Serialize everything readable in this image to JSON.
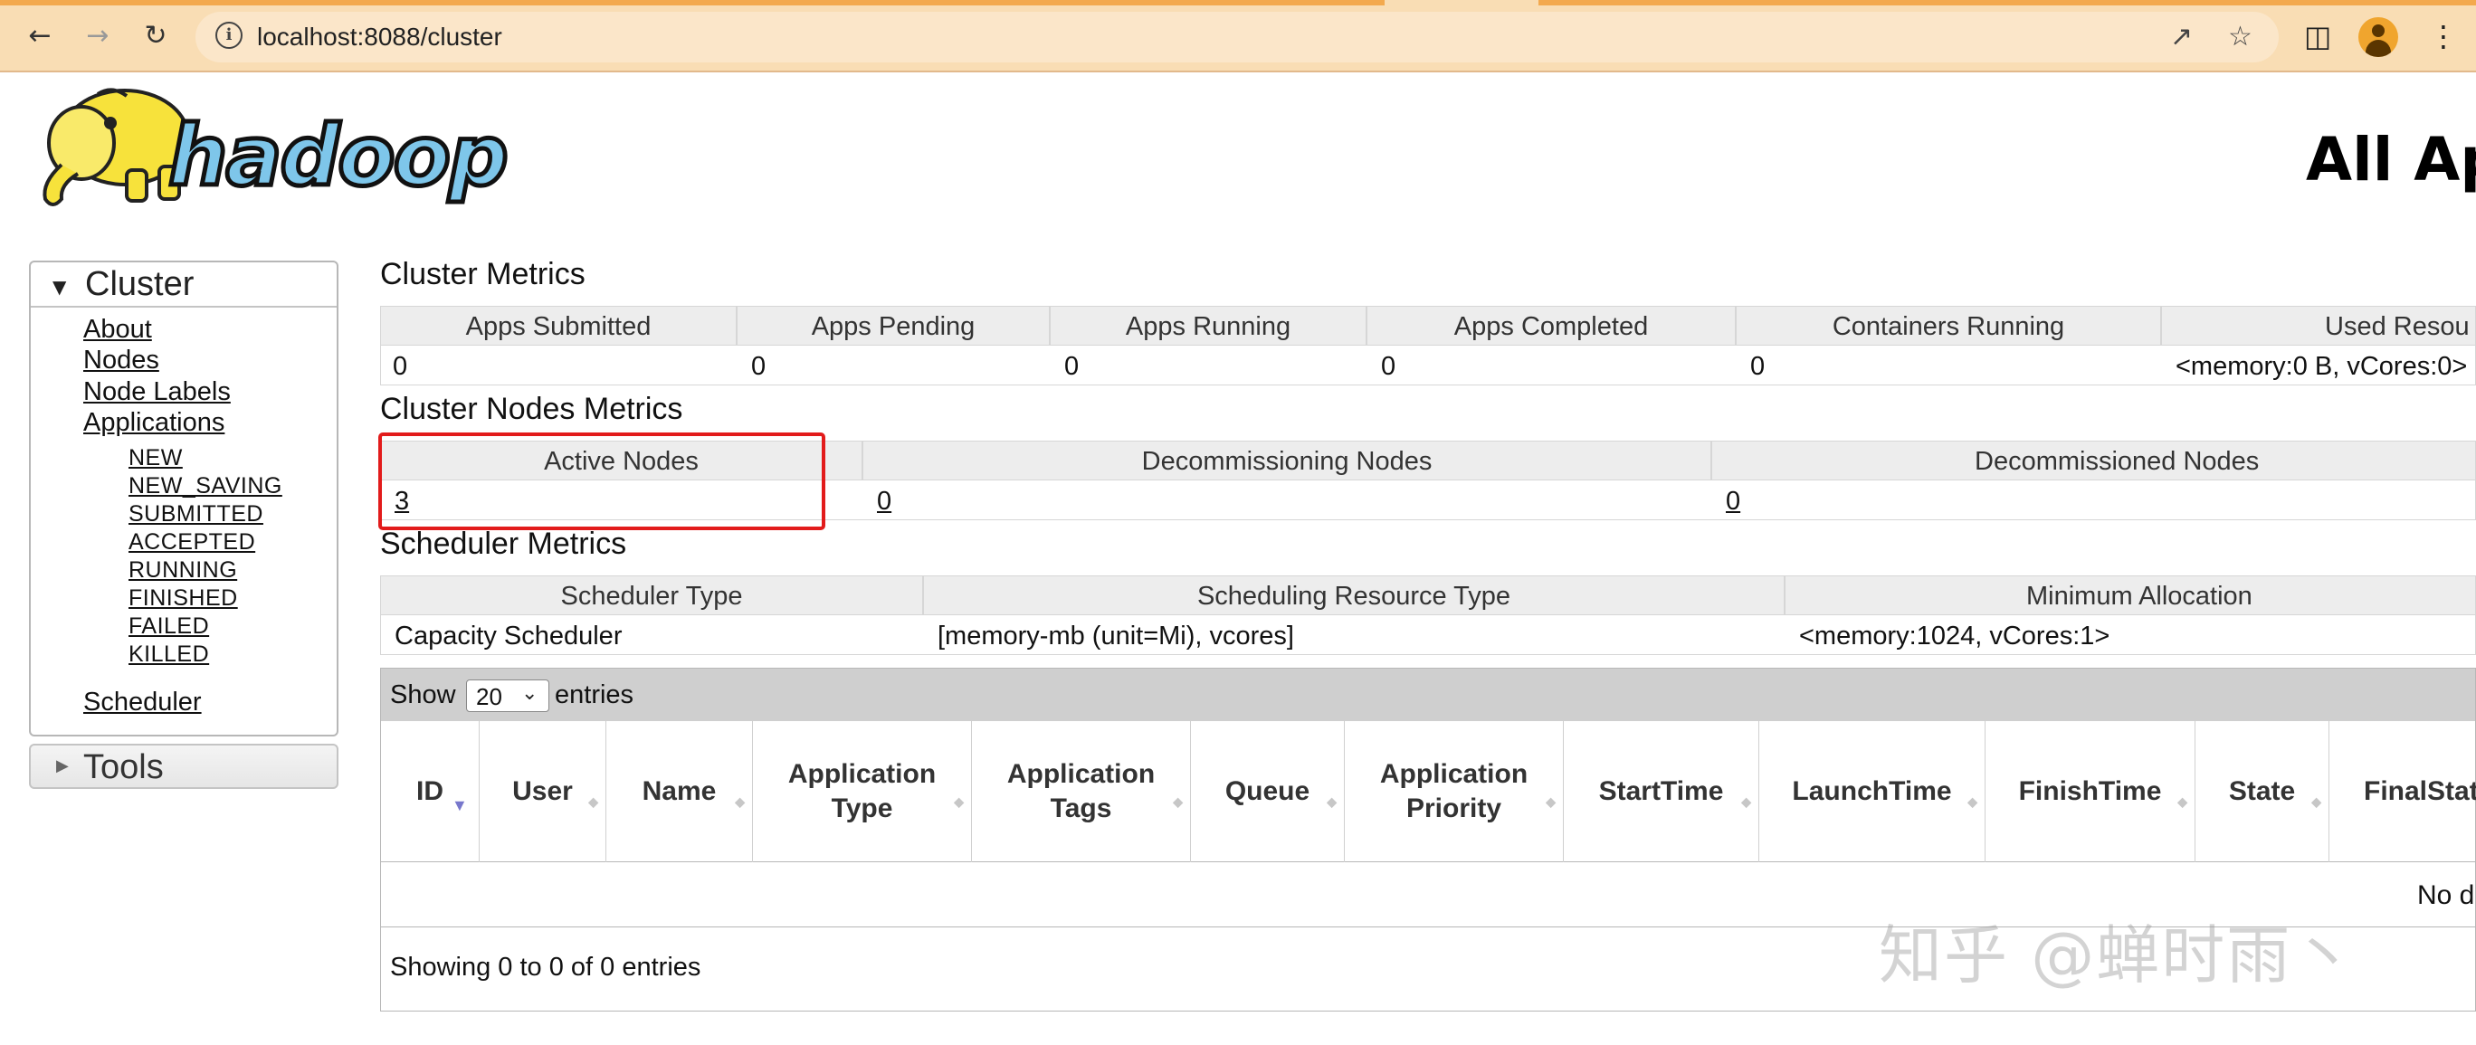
{
  "browser": {
    "url": "localhost:8088/cluster"
  },
  "page": {
    "title": "All Ap"
  },
  "sidebar": {
    "cluster_label": "Cluster",
    "links": [
      "About",
      "Nodes",
      "Node Labels",
      "Applications"
    ],
    "app_states": [
      "NEW",
      "NEW_SAVING",
      "SUBMITTED",
      "ACCEPTED",
      "RUNNING",
      "FINISHED",
      "FAILED",
      "KILLED"
    ],
    "scheduler": "Scheduler",
    "tools_label": "Tools"
  },
  "cluster_metrics": {
    "title": "Cluster Metrics",
    "headers": [
      "Apps Submitted",
      "Apps Pending",
      "Apps Running",
      "Apps Completed",
      "Containers Running",
      "Used Resou"
    ],
    "values": [
      "0",
      "0",
      "0",
      "0",
      "0",
      "<memory:0 B, vCores:0>"
    ]
  },
  "nodes_metrics": {
    "title": "Cluster Nodes Metrics",
    "headers": [
      "Active Nodes",
      "Decommissioning Nodes",
      "Decommissioned Nodes"
    ],
    "values": [
      "3",
      "0",
      "0"
    ]
  },
  "scheduler_metrics": {
    "title": "Scheduler Metrics",
    "headers": [
      "Scheduler Type",
      "Scheduling Resource Type",
      "Minimum Allocation"
    ],
    "values": [
      "Capacity Scheduler",
      "[memory-mb (unit=Mi), vcores]",
      "<memory:1024, vCores:1>"
    ]
  },
  "apps_table": {
    "show_label": "Show",
    "page_size": "20",
    "entries_label": "entries",
    "columns": [
      "ID",
      "User",
      "Name",
      "Application Type",
      "Application Tags",
      "Queue",
      "Application Priority",
      "StartTime",
      "LaunchTime",
      "FinishTime",
      "State",
      "FinalStat"
    ],
    "empty_text": "No d",
    "footer": "Showing 0 to 0 of 0 entries"
  },
  "watermark": "知乎 @蝉时雨丶",
  "colors": {
    "chrome_bg": "#f9ddb4",
    "highlight": "#e21b1b",
    "header_cell": "#ededed"
  }
}
